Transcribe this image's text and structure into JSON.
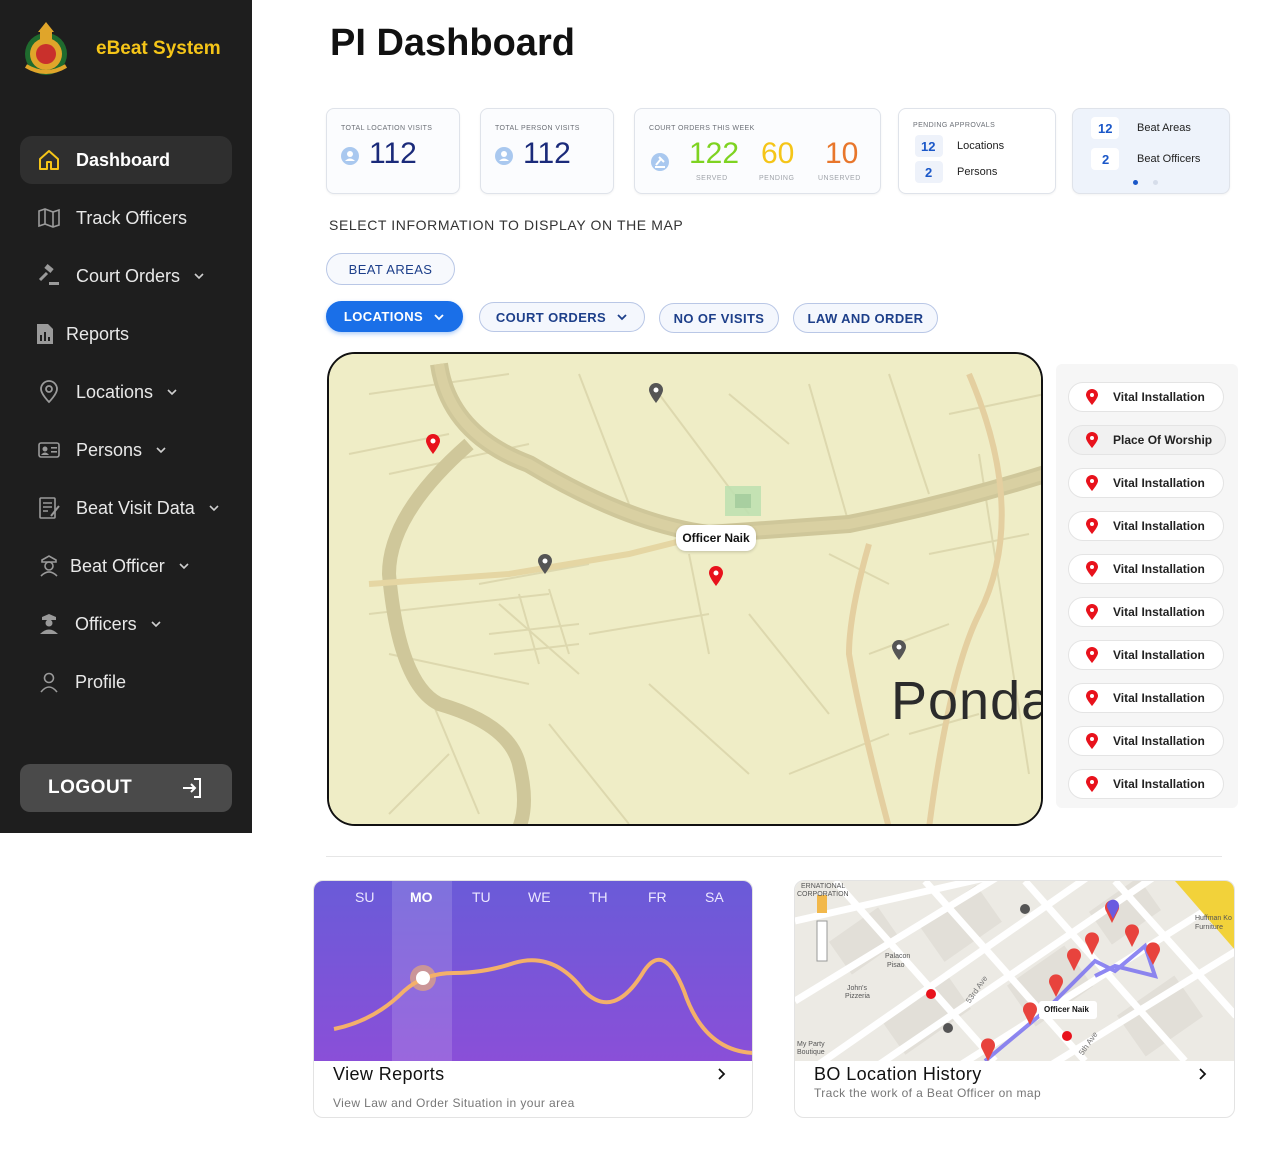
{
  "app": {
    "brand_name": "eBeat System",
    "page_title": "PI Dashboard"
  },
  "sidebar": {
    "items": [
      {
        "label": "Dashboard",
        "icon": "home-icon"
      },
      {
        "label": "Track Officers",
        "icon": "map-icon"
      },
      {
        "label": "Court Orders",
        "icon": "gavel-icon"
      },
      {
        "label": "Reports",
        "icon": "report-icon"
      },
      {
        "label": "Locations",
        "icon": "location-icon"
      },
      {
        "label": "Persons",
        "icon": "id-card-icon"
      },
      {
        "label": "Beat Visit Data",
        "icon": "notes-icon"
      },
      {
        "label": "Beat Officer",
        "icon": "officer-icon"
      },
      {
        "label": "Officers",
        "icon": "police-icon"
      },
      {
        "label": "Profile",
        "icon": "user-icon"
      }
    ],
    "logout_label": "LOGOUT"
  },
  "stats": {
    "location_visits": {
      "label": "TOTAL LOCATION VISITS",
      "value": "112"
    },
    "person_visits": {
      "label": "TOTAL PERSON VISITS",
      "value": "112"
    },
    "court_orders": {
      "label": "COURT ORDERS THIS WEEK",
      "served": "122",
      "served_label": "SERVED",
      "pending": "60",
      "pending_label": "PENDING",
      "unserved": "10",
      "unserved_label": "UNSERVED"
    },
    "pending_approvals": {
      "label": "PENDING APPROVALS",
      "locations_count": "12",
      "locations_label": "Locations",
      "persons_count": "2",
      "persons_label": "Persons"
    },
    "beat": {
      "areas_count": "12",
      "areas_label": "Beat Areas",
      "officers_count": "2",
      "officers_label": "Beat Officers"
    }
  },
  "filters": {
    "section_label": "SELECT INFORMATION TO DISPLAY ON THE MAP",
    "beat_areas": "BEAT AREAS",
    "locations": "LOCATIONS",
    "court_orders": "COURT ORDERS",
    "no_of_visits": "NO OF VISITS",
    "law_and_order": "LAW AND ORDER"
  },
  "map": {
    "officer_label": "Officer Naik",
    "place_label": "Ponda"
  },
  "legend": [
    "Vital Installation",
    "Place Of Worship",
    "Vital Installation",
    "Vital Installation",
    "Vital Installation",
    "Vital Installation",
    "Vital Installation",
    "Vital Installation",
    "Vital Installation",
    "Vital Installation"
  ],
  "tiles": {
    "reports": {
      "days": [
        "SU",
        "MO",
        "TU",
        "WE",
        "TH",
        "FR",
        "SA"
      ],
      "active_day": "MO",
      "title": "View Reports",
      "subtitle": "View Law and Order Situation in your area"
    },
    "history": {
      "title": "BO Location History",
      "subtitle": "Track the work of a Beat Officer on map",
      "map_labels": [
        "ERNATIONAL",
        "CORPORATION",
        "Palacon",
        "Pisao",
        "John's",
        "Pizzeria",
        "My Party",
        "Boutique",
        "53rd Ave",
        "5th Ave",
        "Officer Naik",
        "Huffman Ko",
        "Furniture"
      ]
    }
  },
  "colors": {
    "sidebar_bg": "#1e1e1e",
    "brand_yellow": "#f5c518",
    "primary_blue": "#1a6fe8",
    "served_green": "#7ed321",
    "pending_yellow": "#f5c518",
    "unserved_orange": "#e8762b",
    "pin_red": "#e8121c",
    "pin_gray": "#555555"
  }
}
